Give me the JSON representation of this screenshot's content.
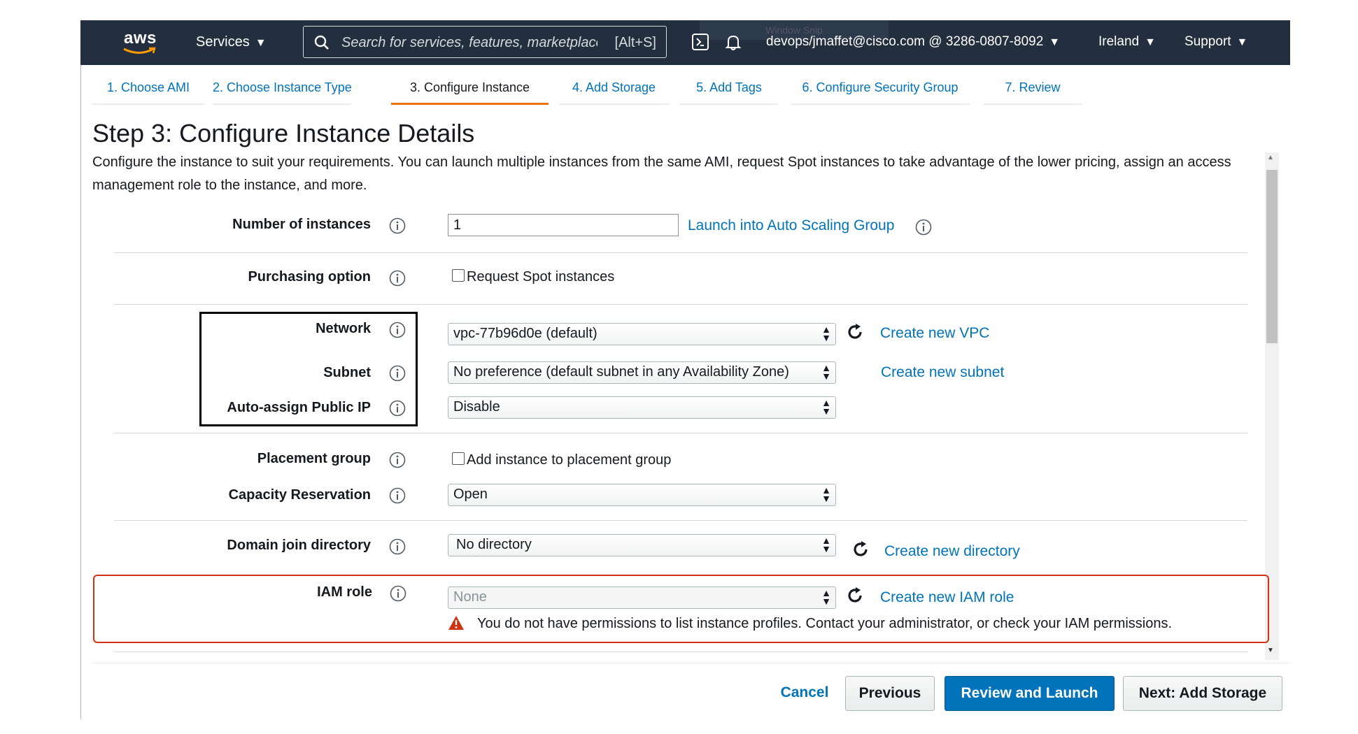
{
  "nav": {
    "logo_text": "aws",
    "services_label": "Services",
    "search_placeholder": "Search for services, features, marketplace products, and docs",
    "search_shortcut": "[Alt+S]",
    "ghost_overlay": "Window Snip",
    "account": "devops/jmaffet@cisco.com @ 3286-0807-8092",
    "region": "Ireland",
    "support": "Support"
  },
  "steps": [
    {
      "label": "1. Choose AMI",
      "active": false
    },
    {
      "label": "2. Choose Instance Type",
      "active": false
    },
    {
      "label": "3. Configure Instance",
      "active": true
    },
    {
      "label": "4. Add Storage",
      "active": false
    },
    {
      "label": "5. Add Tags",
      "active": false
    },
    {
      "label": "6. Configure Security Group",
      "active": false
    },
    {
      "label": "7. Review",
      "active": false
    }
  ],
  "page": {
    "title": "Step 3: Configure Instance Details",
    "description": "Configure the instance to suit your requirements. You can launch multiple instances from the same AMI, request Spot instances to take advantage of the lower pricing, assign an access management role to the instance, and more."
  },
  "form": {
    "num_instances_label": "Number of instances",
    "num_instances_value": "1",
    "asg_link": "Launch into Auto Scaling Group",
    "purchasing_label": "Purchasing option",
    "spot_checkbox": "Request Spot instances",
    "network_label": "Network",
    "network_value": "vpc-77b96d0e (default)",
    "create_vpc": "Create new VPC",
    "subnet_label": "Subnet",
    "subnet_value": "No preference (default subnet in any Availability Zone)",
    "create_subnet": "Create new subnet",
    "public_ip_label": "Auto-assign Public IP",
    "public_ip_value": "Disable",
    "placement_label": "Placement group",
    "placement_checkbox": "Add instance to placement group",
    "capacity_label": "Capacity Reservation",
    "capacity_value": "Open",
    "domain_label": "Domain join directory",
    "domain_value": "No directory",
    "create_directory": "Create new directory",
    "iam_label": "IAM role",
    "iam_value": "None",
    "create_iam": "Create new IAM role",
    "iam_error": "You do not have permissions to list instance profiles. Contact your administrator, or check your IAM permissions."
  },
  "footer": {
    "cancel": "Cancel",
    "previous": "Previous",
    "review_launch": "Review and Launch",
    "next": "Next: Add Storage"
  },
  "colors": {
    "nav_bg": "#232f3e",
    "link": "#0073bb",
    "active_tab": "#ec7211",
    "primary_button": "#0073bb",
    "error": "#d13212"
  }
}
